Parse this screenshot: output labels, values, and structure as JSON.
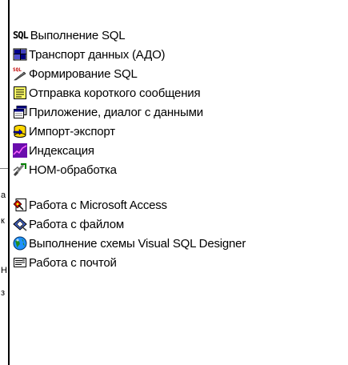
{
  "left_strip": {
    "glyphs": [
      "а",
      "к",
      "Н",
      "з"
    ]
  },
  "menu": {
    "items": [
      {
        "label": "Выполнение SQL",
        "icon": "sql-text-icon",
        "icon_text": "SQL"
      },
      {
        "label": "Транспорт данных (АДО)",
        "icon": "data-transport-icon"
      },
      {
        "label": "Формирование SQL",
        "icon": "sql-builder-icon"
      },
      {
        "label": "Отправка короткого сообщения",
        "icon": "short-message-icon"
      },
      {
        "label": "Приложение, диалог с данными",
        "icon": "app-dialog-icon"
      },
      {
        "label": "Импорт-экспорт",
        "icon": "import-export-icon"
      },
      {
        "label": "Индексация",
        "icon": "indexing-icon"
      },
      {
        "label": "НОМ-обработка",
        "icon": "hom-processing-icon"
      },
      {
        "label": "Работа с Microsoft Access",
        "icon": "access-icon"
      },
      {
        "label": "Работа с файлом",
        "icon": "file-work-icon"
      },
      {
        "label": "Выполнение схемы Visual SQL Designer",
        "icon": "visual-sql-designer-icon"
      },
      {
        "label": "Работа с почтой",
        "icon": "mail-icon"
      }
    ]
  },
  "colors": {
    "background": "#ffffff",
    "text": "#000000",
    "divider": "#000000"
  }
}
